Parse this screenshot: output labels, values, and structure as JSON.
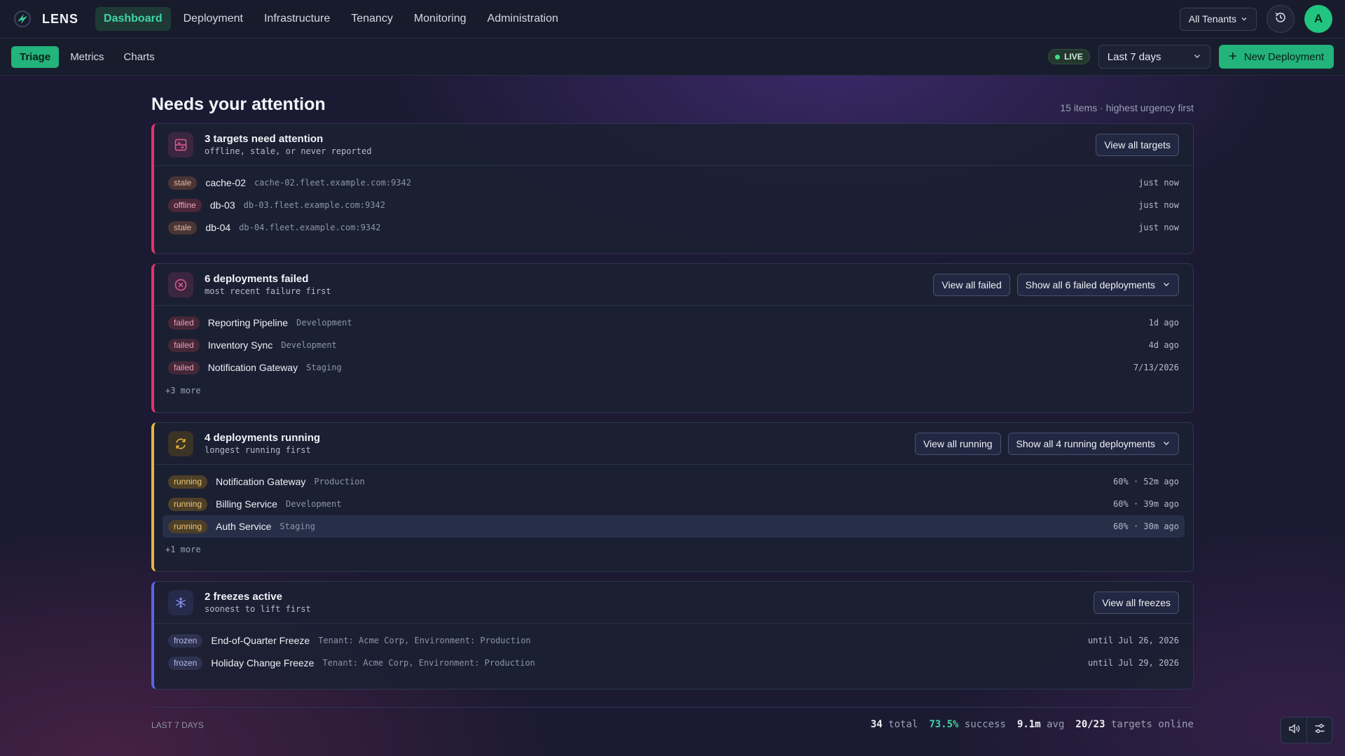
{
  "app": {
    "name": "LENS"
  },
  "nav": {
    "items": [
      {
        "label": "Dashboard",
        "active": true
      },
      {
        "label": "Deployment"
      },
      {
        "label": "Infrastructure"
      },
      {
        "label": "Tenancy"
      },
      {
        "label": "Monitoring"
      },
      {
        "label": "Administration"
      }
    ],
    "tenant": "All Tenants",
    "avatar": "A"
  },
  "subnav": {
    "tabs": [
      {
        "label": "Triage",
        "active": true
      },
      {
        "label": "Metrics"
      },
      {
        "label": "Charts"
      }
    ],
    "live": "LIVE",
    "range": "Last 7 days",
    "new_deployment": "New Deployment"
  },
  "main": {
    "title": "Needs your attention",
    "meta": "15 items · highest urgency first"
  },
  "cards": {
    "targets": {
      "title": "3 targets need attention",
      "subtitle": "offline, stale, or never reported",
      "view_all": "View all targets",
      "rows": [
        {
          "badge": "stale",
          "name": "cache-02",
          "detail": "cache-02.fleet.example.com:9342",
          "time": "just now"
        },
        {
          "badge": "offline",
          "name": "db-03",
          "detail": "db-03.fleet.example.com:9342",
          "time": "just now"
        },
        {
          "badge": "stale",
          "name": "db-04",
          "detail": "db-04.fleet.example.com:9342",
          "time": "just now"
        }
      ]
    },
    "failed": {
      "title": "6 deployments failed",
      "subtitle": "most recent failure first",
      "view_all": "View all failed",
      "show_all": "Show all 6 failed deployments",
      "rows": [
        {
          "badge": "failed",
          "name": "Reporting Pipeline",
          "detail": "Development",
          "time": "1d ago"
        },
        {
          "badge": "failed",
          "name": "Inventory Sync",
          "detail": "Development",
          "time": "4d ago"
        },
        {
          "badge": "failed",
          "name": "Notification Gateway",
          "detail": "Staging",
          "time": "7/13/2026"
        }
      ],
      "more": "+3 more"
    },
    "running": {
      "title": "4 deployments running",
      "subtitle": "longest running first",
      "view_all": "View all running",
      "show_all": "Show all 4 running deployments",
      "rows": [
        {
          "badge": "running",
          "name": "Notification Gateway",
          "detail": "Production",
          "time": "60% · 52m ago"
        },
        {
          "badge": "running",
          "name": "Billing Service",
          "detail": "Development",
          "time": "60% · 39m ago"
        },
        {
          "badge": "running",
          "name": "Auth Service",
          "detail": "Staging",
          "time": "60% · 30m ago"
        }
      ],
      "more": "+1 more"
    },
    "freezes": {
      "title": "2 freezes active",
      "subtitle": "soonest to lift first",
      "view_all": "View all freezes",
      "rows": [
        {
          "badge": "frozen",
          "name": "End-of-Quarter Freeze",
          "detail": "Tenant: Acme Corp, Environment: Production",
          "time": "until Jul 26, 2026"
        },
        {
          "badge": "frozen",
          "name": "Holiday Change Freeze",
          "detail": "Tenant: Acme Corp, Environment: Production",
          "time": "until Jul 29, 2026"
        }
      ]
    }
  },
  "footer": {
    "period": "LAST 7 DAYS",
    "total_value": "34",
    "total_label": "total",
    "success_value": "73.5%",
    "success_label": "success",
    "avg_value": "9.1m",
    "avg_label": "avg",
    "targets_value": "20/23",
    "targets_label": "targets online"
  },
  "colors": {
    "accent": "#22b47a",
    "failed": "#e0356a",
    "running": "#e8b53a",
    "frozen": "#5b63e6"
  },
  "icons": {
    "logo": "lens-logo-icon",
    "history": "history-icon",
    "targets": "server-icon",
    "failed": "x-circle-icon",
    "running": "refresh-icon",
    "freezes": "snowflake-icon",
    "sound": "speaker-icon",
    "settings": "sliders-icon"
  }
}
